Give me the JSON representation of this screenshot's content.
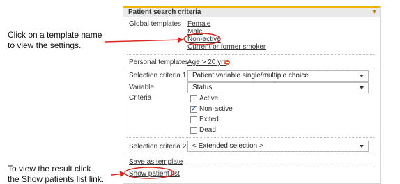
{
  "callouts": {
    "template_line1": "Click on a template name",
    "template_line2": "to view the settings.",
    "result_line1": "To view the result click",
    "result_line2": "the Show patients list link."
  },
  "panel": {
    "title": "Patient search criteria",
    "global_templates_label": "Global templates",
    "global_templates": [
      "Female",
      "Male",
      "Non-active",
      "Current or former smoker"
    ],
    "personal_templates_label": "Personal templates",
    "personal_template": "Age > 20 yrs",
    "selection_criteria_1_label": "Selection criteria 1",
    "selection_criteria_1_value": "Patient variable single/multiple choice",
    "variable_label": "Variable",
    "variable_value": "Status",
    "criteria_label": "Criteria",
    "criteria_options": [
      {
        "label": "Active",
        "checked": false
      },
      {
        "label": "Non-active",
        "checked": true
      },
      {
        "label": "Exited",
        "checked": false
      },
      {
        "label": "Dead",
        "checked": false
      }
    ],
    "selection_criteria_2_label": "Selection criteria 2",
    "selection_criteria_2_value": "< Extended selection >",
    "save_as_template": "Save as template",
    "show_patient_list": "Show patient list"
  },
  "colors": {
    "header_accent": "#f0b400",
    "annotation": "#d9261c",
    "remove": "#e0502a"
  },
  "icons": [
    "collapse-icon",
    "remove-icon",
    "checkbox-icon",
    "dropdown-caret-icon"
  ]
}
